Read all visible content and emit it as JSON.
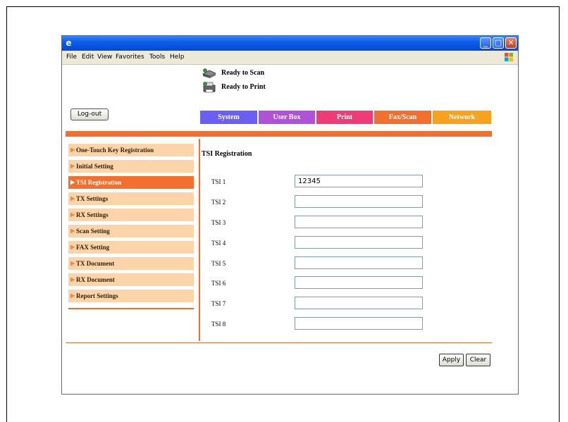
{
  "menu": [
    "File",
    "Edit",
    "View",
    "Favorites",
    "Tools",
    "Help"
  ],
  "status": {
    "scan": "Ready to Scan",
    "print": "Ready to Print"
  },
  "logout_label": "Log-out",
  "tabs": [
    {
      "label": "System",
      "color": "#6a5ff0"
    },
    {
      "label": "User Box",
      "color": "#b052d8"
    },
    {
      "label": "Print",
      "color": "#ee3c78"
    },
    {
      "label": "Fax/Scan",
      "color": "#f26f2d"
    },
    {
      "label": "Network",
      "color": "#f7a21c"
    }
  ],
  "sidebar": {
    "active_index": 2,
    "items": [
      "One-Touch Key Registration",
      "Initial Setting",
      "TSI Registration",
      "TX Settings",
      "RX Settings",
      "Scan Setting",
      "FAX Setting",
      "TX Document",
      "RX Document",
      "Report Settings"
    ]
  },
  "content": {
    "title": "TSI Registration",
    "fields": [
      {
        "label": "TSI 1",
        "value": "12345"
      },
      {
        "label": "TSI 2",
        "value": ""
      },
      {
        "label": "TSI 3",
        "value": ""
      },
      {
        "label": "TSI 4",
        "value": ""
      },
      {
        "label": "TSI 5",
        "value": ""
      },
      {
        "label": "TSI 6",
        "value": ""
      },
      {
        "label": "TSI 7",
        "value": ""
      },
      {
        "label": "TSI 8",
        "value": ""
      }
    ]
  },
  "buttons": {
    "apply": "Apply",
    "clear": "Clear"
  },
  "colors": {
    "accent": "#f26f2d",
    "sidebar_bg": "#fbd4aa"
  }
}
